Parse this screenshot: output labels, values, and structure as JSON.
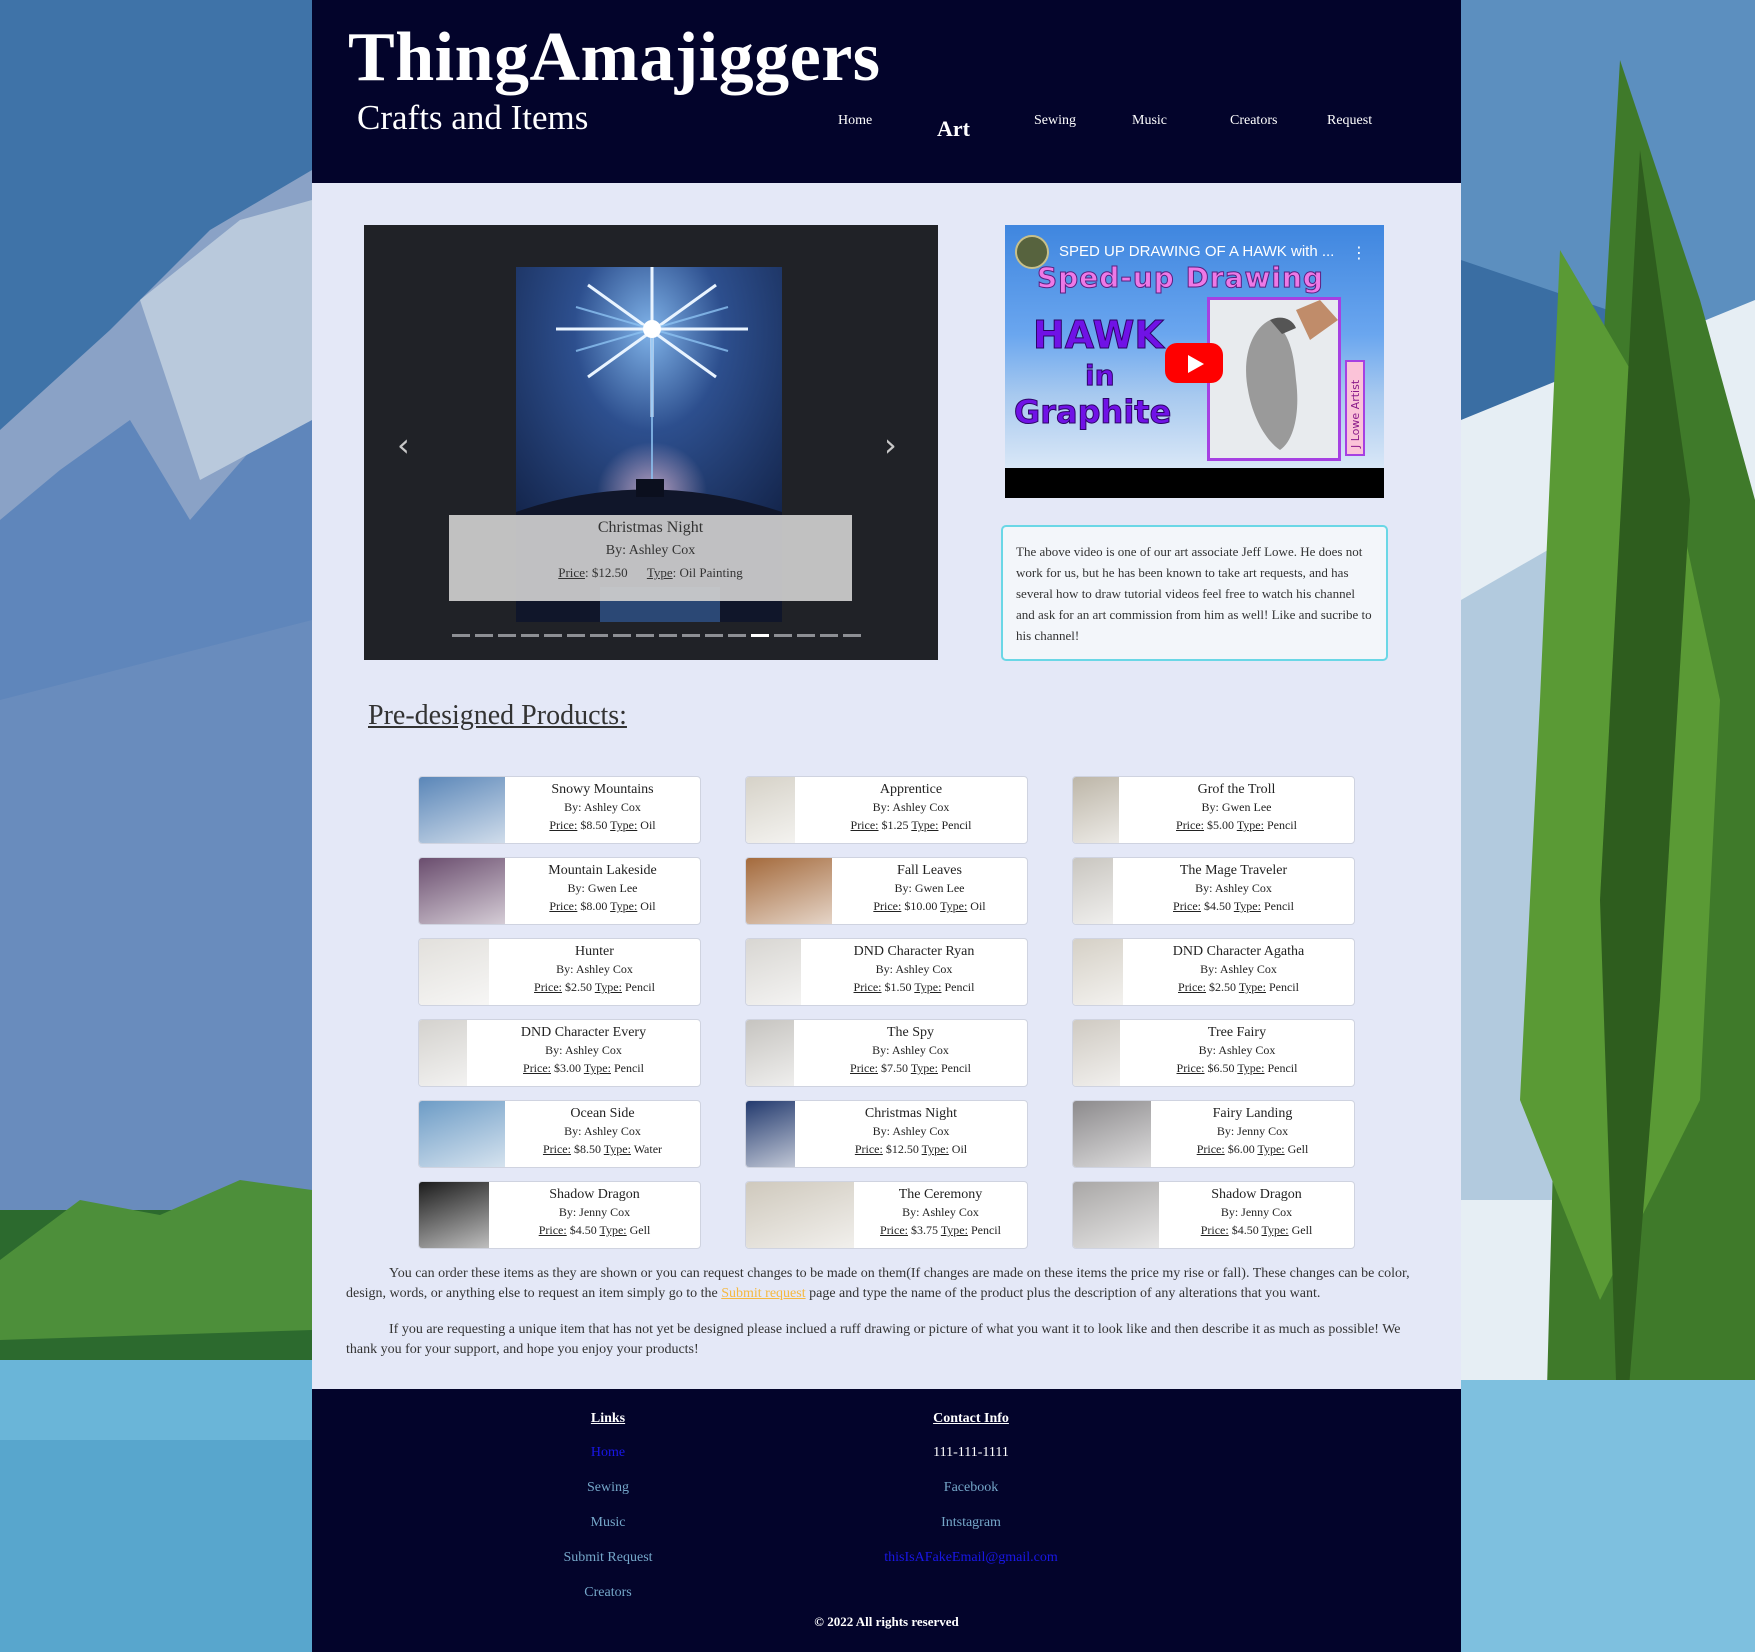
{
  "site": {
    "title": "ThingAmajiggers",
    "subtitle": "Crafts and Items"
  },
  "nav": [
    {
      "label": "Home",
      "active": false
    },
    {
      "label": "Art",
      "active": true
    },
    {
      "label": "Sewing",
      "active": false
    },
    {
      "label": "Music",
      "active": false
    },
    {
      "label": "Creators",
      "active": false
    },
    {
      "label": "Request",
      "active": false
    }
  ],
  "carousel": {
    "title": "Christmas Night",
    "by": "By: Ashley Cox",
    "price_label": "Price",
    "price": ": $12.50",
    "type_label": "Type",
    "type": ": Oil Painting",
    "slide_count": 18,
    "active_index": 13,
    "prev_icon": "chevron-left-icon",
    "next_icon": "chevron-right-icon"
  },
  "video": {
    "title": "SPED UP DRAWING OF A HAWK with ...",
    "heading": "Sped-up Drawing",
    "word1": "HAWK",
    "word2": "in",
    "word3": "Graphite",
    "side_label": "J Lowe Artist"
  },
  "info_text": "The above video is one of our art associate Jeff Lowe. He does not work for us, but he has been known to take art requests, and has several how to draw tutorial videos feel free to watch his channel and ask for an art commission from him as well! Like and sucribe to his channel!",
  "products_title": "Pre-designed Products:",
  "price_label": "Price:",
  "type_label": "Type:",
  "products": [
    {
      "name": "Snowy Mountains",
      "by": "By: Ashley Cox",
      "price": " $8.50 ",
      "type": " Oil",
      "thumb_w": 86,
      "color": "#5a86b8"
    },
    {
      "name": "Apprentice",
      "by": "By: Ashley Cox",
      "price": " $1.25 ",
      "type": " Pencil",
      "thumb_w": 49,
      "color": "#d6d2c8"
    },
    {
      "name": "Grof the Troll",
      "by": "By: Gwen Lee",
      "price": " $5.00 ",
      "type": " Pencil",
      "thumb_w": 46,
      "color": "#bdb6a8"
    },
    {
      "name": "Mountain Lakeside",
      "by": "By: Gwen Lee",
      "price": " $8.00 ",
      "type": " Oil",
      "thumb_w": 86,
      "color": "#6a4d6e"
    },
    {
      "name": "Fall Leaves",
      "by": "By: Gwen Lee",
      "price": " $10.00 ",
      "type": " Oil",
      "thumb_w": 86,
      "color": "#a46a3c"
    },
    {
      "name": "The Mage Traveler",
      "by": "By: Ashley Cox",
      "price": " $4.50 ",
      "type": " Pencil",
      "thumb_w": 40,
      "color": "#c9c6c0"
    },
    {
      "name": "Hunter",
      "by": "By: Ashley Cox",
      "price": " $2.50 ",
      "type": " Pencil",
      "thumb_w": 70,
      "color": "#e2e0dc"
    },
    {
      "name": "DND Character Ryan",
      "by": "By: Ashley Cox",
      "price": " $1.50 ",
      "type": " Pencil",
      "thumb_w": 55,
      "color": "#d8d6d2"
    },
    {
      "name": "DND Character Agatha",
      "by": "By: Ashley Cox",
      "price": " $2.50 ",
      "type": " Pencil",
      "thumb_w": 50,
      "color": "#d5d0c6"
    },
    {
      "name": "DND Character Every",
      "by": "By: Ashley Cox",
      "price": " $3.00 ",
      "type": " Pencil",
      "thumb_w": 48,
      "color": "#d4d2ce"
    },
    {
      "name": "The Spy",
      "by": "By: Ashley Cox",
      "price": " $7.50 ",
      "type": " Pencil",
      "thumb_w": 48,
      "color": "#c6c4c0"
    },
    {
      "name": "Tree Fairy",
      "by": "By: Ashley Cox",
      "price": " $6.50 ",
      "type": " Pencil",
      "thumb_w": 47,
      "color": "#cfcac2"
    },
    {
      "name": "Ocean Side",
      "by": "By: Ashley Cox",
      "price": " $8.50 ",
      "type": " Water",
      "thumb_w": 86,
      "color": "#6d9cc6"
    },
    {
      "name": "Christmas Night",
      "by": "By: Ashley Cox",
      "price": " $12.50 ",
      "type": " Oil",
      "thumb_w": 49,
      "color": "#233a6e"
    },
    {
      "name": "Fairy Landing",
      "by": "By: Jenny Cox",
      "price": " $6.00 ",
      "type": " Gell",
      "thumb_w": 78,
      "color": "#8c8a8c"
    },
    {
      "name": "Shadow Dragon",
      "by": "By: Jenny Cox",
      "price": " $4.50 ",
      "type": " Gell",
      "thumb_w": 70,
      "color": "#1c1c1c"
    },
    {
      "name": "The Ceremony",
      "by": "By: Ashley Cox",
      "price": " $3.75 ",
      "type": " Pencil",
      "thumb_w": 108,
      "color": "#cfc9bd"
    },
    {
      "name": "Shadow Dragon",
      "by": "By: Jenny Cox",
      "price": " $4.50 ",
      "type": " Gell",
      "thumb_w": 86,
      "color": "#a9a7a6"
    }
  ],
  "paragraph1": {
    "before": "You can order these items as they are shown or you can request changes to be made on them(If changes are made on these items the price my rise or fall). These changes can be color, design, words, or anything else to request an item simply go to the ",
    "link": "Submit request",
    "after": " page and type the name of the product plus the description of any alterations that you want."
  },
  "paragraph2": "If you are requesting a unique item that has not yet be designed please inclued a ruff drawing or picture of what you want it to look like and then describe it as much as possible! We thank you for your support, and hope you enjoy your products!",
  "footer": {
    "links_heading": "Links",
    "links": [
      "Home",
      "Sewing",
      "Music",
      "Submit Request",
      "Creators"
    ],
    "contact_heading": "Contact Info",
    "phone": "111-111-1111",
    "facebook": "Facebook",
    "instagram": "Intstagram",
    "email": "thisIsAFakeEmail@gmail.com",
    "copyright": "© 2022 All rights reserved"
  },
  "colors": {
    "header_bg": "#03042b",
    "page_bg": "#e4e8f7",
    "link_accent": "#f5b940",
    "info_border": "#6ad7e6"
  }
}
